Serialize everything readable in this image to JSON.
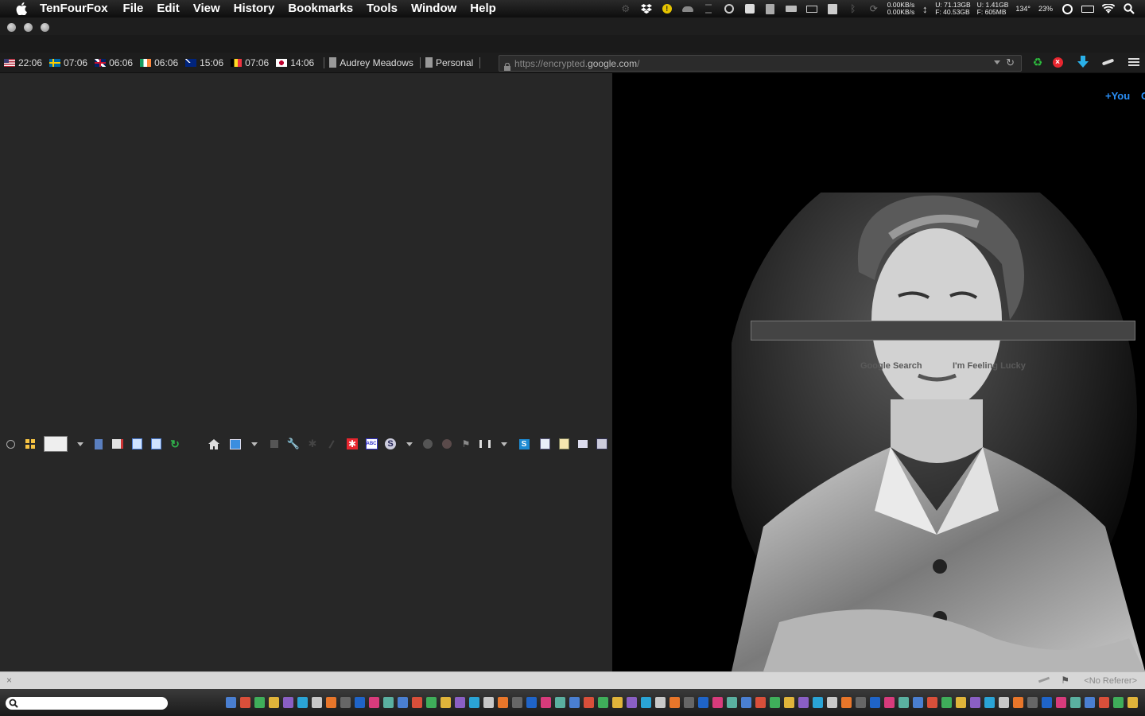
{
  "menubar": {
    "app_name": "TenFourFox",
    "menus": [
      "File",
      "Edit",
      "View",
      "History",
      "Bookmarks",
      "Tools",
      "Window",
      "Help"
    ],
    "net_up": "0.00KB/s",
    "net_down": "0.00KB/s",
    "disk_used": "U: 71.13GB",
    "disk_free": "F: 40.53GB",
    "mem_used": "U: 1.41GB",
    "mem_free": "F: 605MB",
    "temp": "134°",
    "cpu": "23%"
  },
  "clocks": [
    {
      "flag": "us",
      "time": "22:06"
    },
    {
      "flag": "se",
      "time": "07:06"
    },
    {
      "flag": "gb",
      "time": "06:06"
    },
    {
      "flag": "ie",
      "time": "06:06"
    },
    {
      "flag": "au",
      "time": "15:06"
    },
    {
      "flag": "be",
      "time": "07:06"
    },
    {
      "flag": "jp",
      "time": "14:06"
    }
  ],
  "bookmarks": [
    {
      "label": "Audrey Meadows"
    },
    {
      "label": "Personal"
    }
  ],
  "urlbar": {
    "prefix": "https://encrypted.",
    "domain": "google.com",
    "suffix": "/"
  },
  "page": {
    "plus_you": "+You",
    "plus_you_cut": "G",
    "search_button": "Google Search",
    "lucky_button": "I'm Feeling Lucky"
  },
  "statusbar": {
    "close": "×",
    "referer": "<No Referer>"
  },
  "colors": {
    "accent": "#2a8ff7",
    "sidebar_bg": "#272727",
    "statusbar_bg": "#d7d7d7"
  }
}
